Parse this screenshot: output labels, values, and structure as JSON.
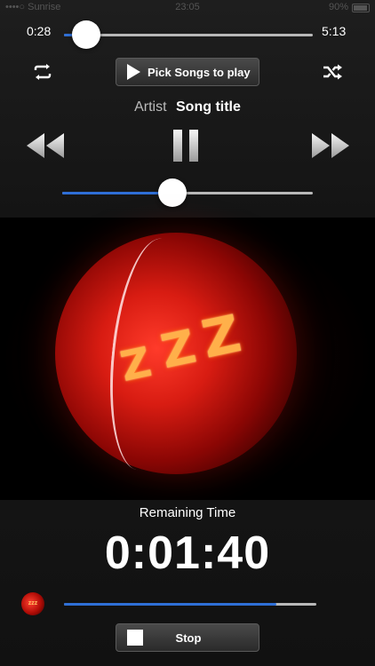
{
  "status_bar": {
    "carrier": "••••○ Sunrise",
    "clock": "23:05",
    "battery": "90%"
  },
  "player": {
    "elapsed": "0:28",
    "duration": "5:13",
    "progress_fraction": 0.09,
    "repeat_icon": "repeat-icon",
    "shuffle_icon": "shuffle-icon",
    "pick_songs_label": "Pick Songs to play",
    "artist": "Artist",
    "song_title": "Song title",
    "rewind_icon": "rewind-icon",
    "pause_icon": "pause-icon",
    "fast_forward_icon": "fast-forward-icon",
    "volume_fraction": 0.44
  },
  "artwork": {
    "zzz": "ZZZ"
  },
  "timer": {
    "remaining_label": "Remaining Time",
    "remaining_value": "0:01:40",
    "progress_fraction": 0.84,
    "stop_label": "Stop",
    "mini_icon_text": "zzz"
  },
  "colors": {
    "accent": "#2f6fd6",
    "background": "#141414",
    "art_red": "#d81c12"
  }
}
